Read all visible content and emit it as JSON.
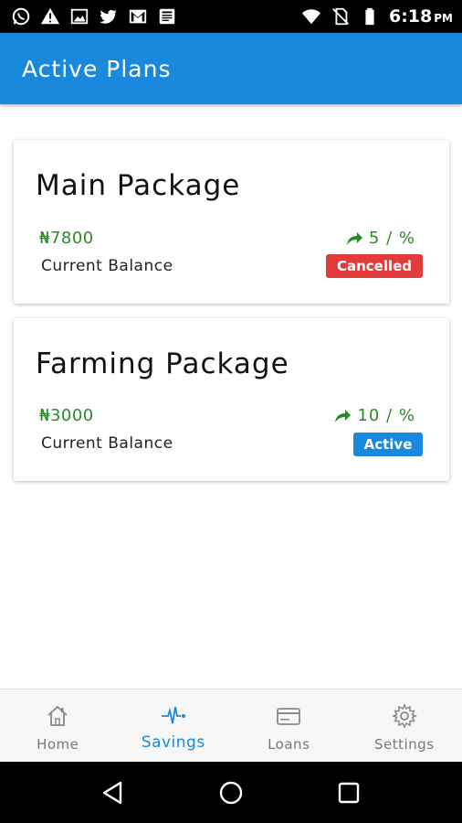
{
  "status_bar": {
    "time": "6:18",
    "ampm": "PM",
    "left_icons": [
      "whatsapp-icon",
      "warning-icon",
      "image-icon",
      "twitter-icon",
      "gmail-icon",
      "news-icon"
    ],
    "right_icons": [
      "wifi-icon",
      "no-sim-icon",
      "battery-icon"
    ]
  },
  "app_bar": {
    "title": "Active Plans",
    "color": "#1a88dc"
  },
  "plans": [
    {
      "title": "Main Package",
      "amount": "₦7800",
      "balance_label": "Current Balance",
      "rate": "5 / %",
      "status": "Cancelled",
      "status_color": "#e23b3b"
    },
    {
      "title": "Farming Package",
      "amount": "₦3000",
      "balance_label": "Current Balance",
      "rate": "10 / %",
      "status": "Active",
      "status_color": "#1a88dc"
    }
  ],
  "bottom_nav": {
    "items": [
      {
        "label": "Home",
        "icon": "home-icon",
        "active": false
      },
      {
        "label": "Savings",
        "icon": "pulse-icon",
        "active": true
      },
      {
        "label": "Loans",
        "icon": "card-icon",
        "active": false
      },
      {
        "label": "Settings",
        "icon": "gear-icon",
        "active": false
      }
    ]
  },
  "system_nav": [
    "back-icon",
    "home-circle-icon",
    "recents-icon"
  ],
  "colors": {
    "accent": "#1a88dc",
    "amount_green": "#2a8a2a",
    "cancelled_red": "#e23b3b"
  }
}
